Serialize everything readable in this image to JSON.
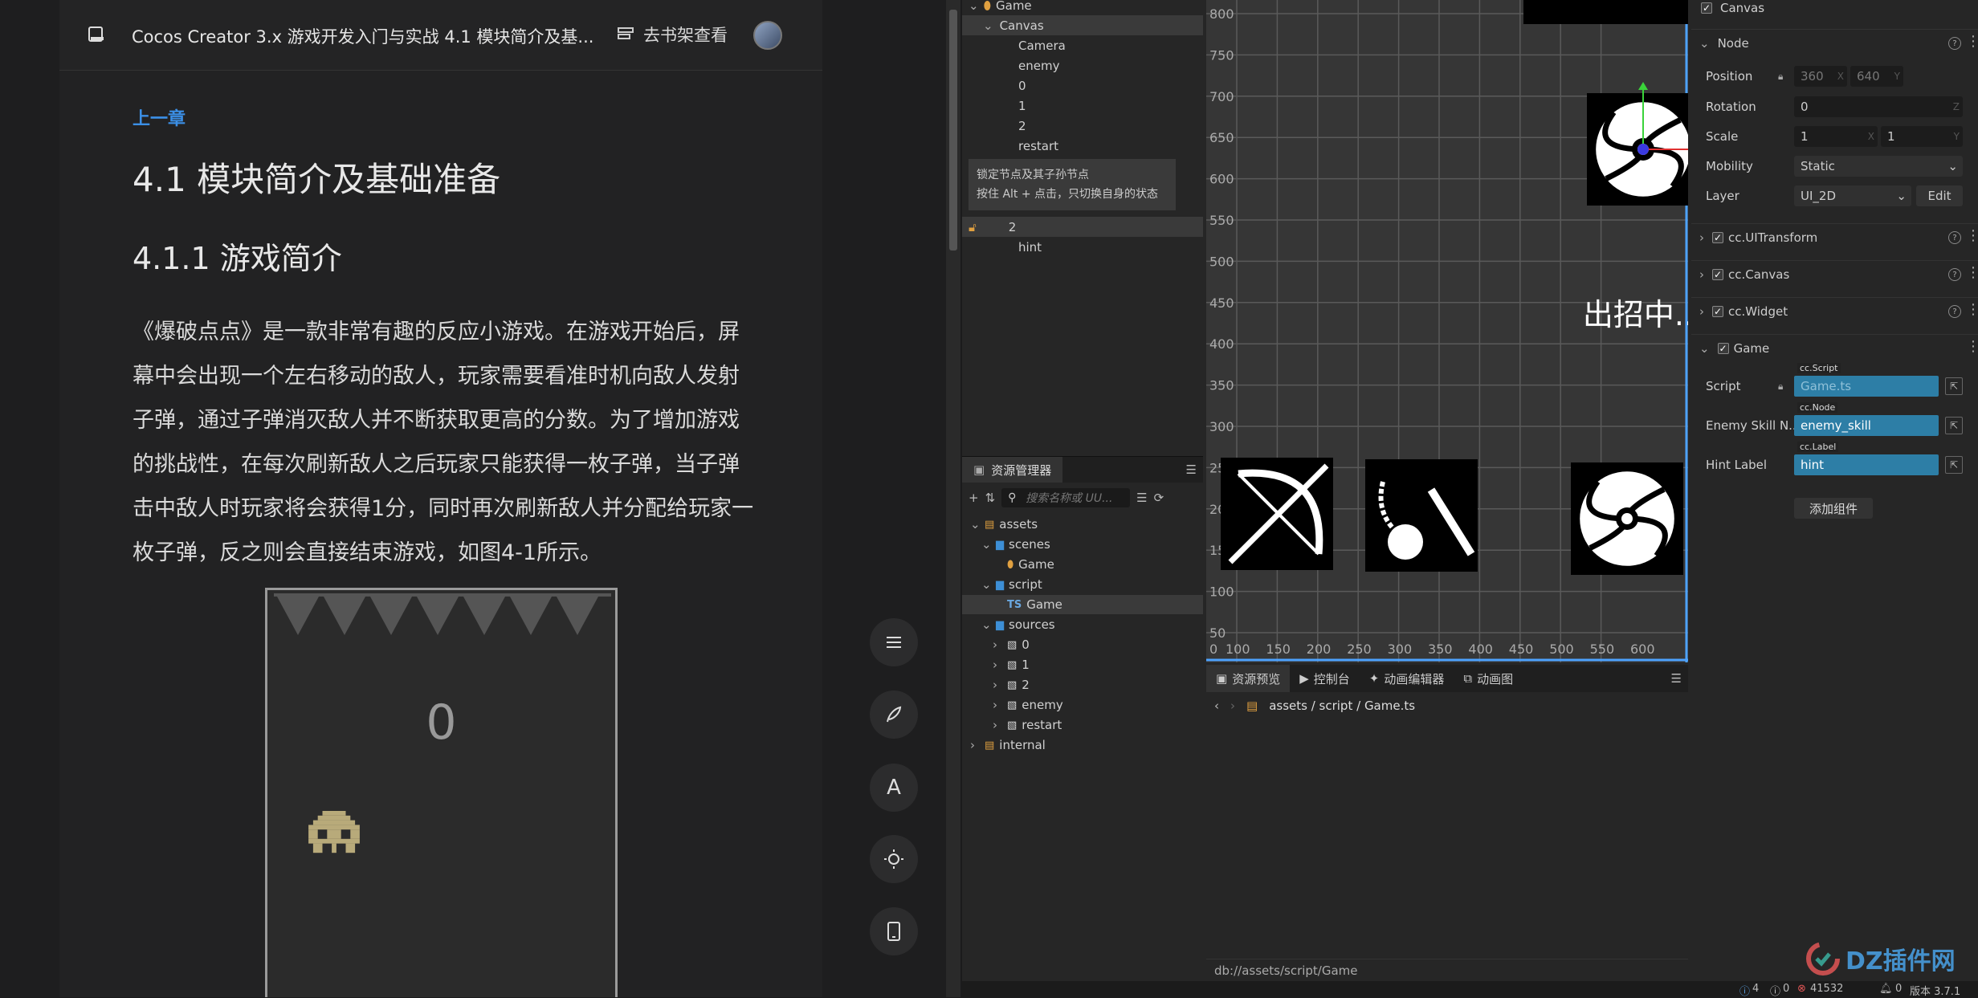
{
  "reader": {
    "title": "Cocos Creator 3.x 游戏开发入门与实战 4.1 模块简介及基...",
    "shelf_label": "去书架查看",
    "prev_chapter": "上一章",
    "heading1": "4.1 模块简介及基础准备",
    "heading2": "4.1.1 游戏简介",
    "paragraph": "《爆破点点》是一款非常有趣的反应小游戏。在游戏开始后，屏幕中会出现一个左右移动的敌人，玩家需要看准时机向敌人发射子弹，通过子弹消灭敌人并不断获取更高的分数。为了增加游戏的挑战性，在每次刷新敌人之后玩家只能获得一枚子弹，当子弹击中敌人时玩家将会获得1分，同时再次刷新敌人并分配给玩家一枚子弹，反之则会直接结束游戏，如图4-1所示。",
    "figure_score": "0",
    "fab_icons": [
      "menu-icon",
      "feather-icon",
      "font-icon",
      "brightness-icon",
      "phone-icon"
    ],
    "fab_font_glyph": "A"
  },
  "hierarchy": {
    "items": [
      {
        "label": "Game",
        "level": 0,
        "expanded": true,
        "icon": "scene-icon"
      },
      {
        "label": "Canvas",
        "level": 1,
        "expanded": true,
        "selected": true
      },
      {
        "label": "Camera",
        "level": 2
      },
      {
        "label": "enemy",
        "level": 2
      },
      {
        "label": "0",
        "level": 2
      },
      {
        "label": "1",
        "level": 2
      },
      {
        "label": "2",
        "level": 2
      },
      {
        "label": "restart",
        "level": 2
      }
    ],
    "tooltip_line1": "锁定节点及其子孙节点",
    "tooltip_line2": "按住 Alt + 点击，只切换自身的状态",
    "locked_item": "2",
    "after_item": "hint"
  },
  "assets_panel": {
    "tab_label": "资源管理器",
    "search_placeholder": "搜索名称或 UU...",
    "tree": [
      {
        "label": "assets",
        "level": 0,
        "type": "db"
      },
      {
        "label": "scenes",
        "level": 1,
        "type": "folder"
      },
      {
        "label": "Game",
        "level": 2,
        "type": "scene"
      },
      {
        "label": "script",
        "level": 1,
        "type": "folder"
      },
      {
        "label": "Game",
        "level": 2,
        "type": "ts",
        "selected": true
      },
      {
        "label": "sources",
        "level": 1,
        "type": "folder"
      },
      {
        "label": "0",
        "level": 2,
        "type": "image"
      },
      {
        "label": "1",
        "level": 2,
        "type": "image"
      },
      {
        "label": "2",
        "level": 2,
        "type": "image"
      },
      {
        "label": "enemy",
        "level": 2,
        "type": "image"
      },
      {
        "label": "restart",
        "level": 2,
        "type": "image"
      },
      {
        "label": "internal",
        "level": 0,
        "type": "db"
      }
    ],
    "ts_badge": "TS"
  },
  "scene": {
    "y_ticks": [
      "800",
      "750",
      "700",
      "650",
      "600",
      "550",
      "500",
      "450",
      "400",
      "350",
      "300",
      "250",
      "200",
      "150",
      "100",
      "50"
    ],
    "x_ticks": [
      "0",
      "100",
      "150",
      "200",
      "250",
      "300",
      "350",
      "400",
      "450",
      "500",
      "550",
      "600"
    ],
    "label_text": "出招中..."
  },
  "preview": {
    "tabs": [
      "资源预览",
      "控制台",
      "动画编辑器",
      "动画图"
    ],
    "breadcrumb": [
      "assets",
      "script",
      "Game.ts"
    ],
    "db_path": "db://assets/script/Game"
  },
  "inspector": {
    "node_name": "Canvas",
    "node_section": "Node",
    "position_label": "Position",
    "position_x": "360",
    "position_y": "640",
    "rotation_label": "Rotation",
    "rotation": "0",
    "scale_label": "Scale",
    "scale_x": "1",
    "scale_y": "1",
    "mobility_label": "Mobility",
    "mobility": "Static",
    "layer_label": "Layer",
    "layer": "UI_2D",
    "edit_label": "Edit",
    "components": [
      "cc.UITransform",
      "cc.Canvas",
      "cc.Widget"
    ],
    "game_component": "Game",
    "script_label": "Script",
    "script_tag": "cc.Script",
    "script_value": "Game.ts",
    "enemy_label": "Enemy Skill N...",
    "enemy_tag": "cc.Node",
    "enemy_value": "enemy_skill",
    "hint_label": "Hint Label",
    "hint_tag": "cc.Label",
    "hint_value": "hint",
    "add_component": "添加组件",
    "axis_x": "X",
    "axis_y": "Y",
    "axis_z": "Z"
  },
  "status": {
    "info_count": "4",
    "warn_count": "0",
    "error_count": "41532",
    "notif_count": "0",
    "version": "版本 3.7.1",
    "watermark": "DZ插件网"
  },
  "colors": {
    "accent_blue": "#2d7ea6",
    "link_blue": "#3b8fe6",
    "error_red": "#e05555"
  }
}
